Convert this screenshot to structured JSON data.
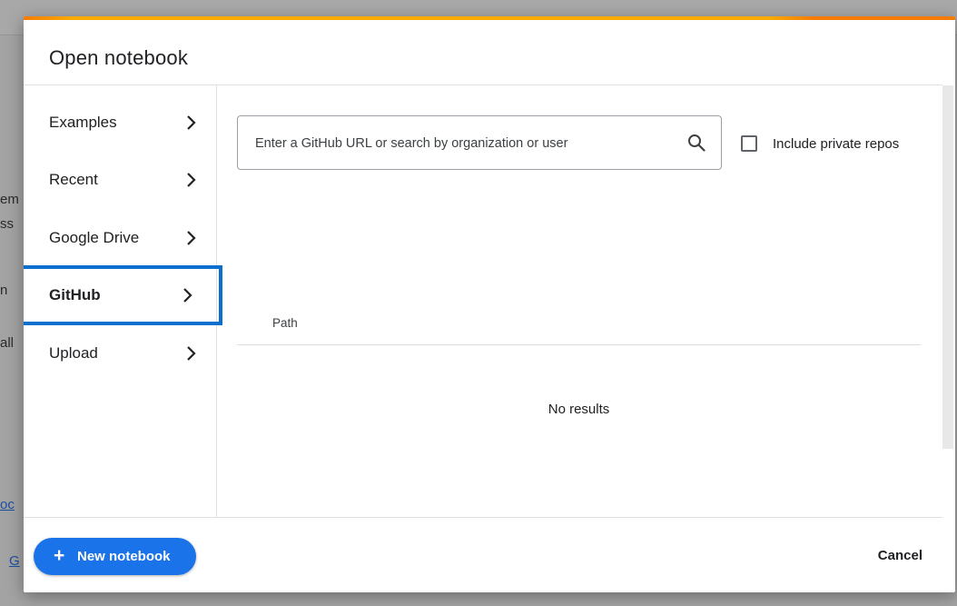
{
  "dialog": {
    "title": "Open notebook"
  },
  "background": {
    "fragments": [
      "em",
      "ss",
      "n",
      "all",
      "oc",
      "G"
    ]
  },
  "sidebar": {
    "items": [
      {
        "label": "Examples",
        "selected": false
      },
      {
        "label": "Recent",
        "selected": false
      },
      {
        "label": "Google Drive",
        "selected": false
      },
      {
        "label": "GitHub",
        "selected": true
      },
      {
        "label": "Upload",
        "selected": false
      }
    ],
    "chevron_icon": "chevron-right-icon"
  },
  "github": {
    "search_placeholder": "Enter a GitHub URL or search by organization or user",
    "search_value": "",
    "search_icon": "search-icon",
    "include_private_label": "Include private repos",
    "include_private_checked": false,
    "table_header_path": "Path",
    "empty_message": "No results"
  },
  "footer": {
    "new_notebook_plus": "+",
    "new_notebook_label": "New notebook",
    "cancel_label": "Cancel"
  },
  "colors": {
    "accent_orange": "#f57c00",
    "accent_yellow": "#f9ab00",
    "primary_blue": "#1a73e8",
    "selection_outline": "#0b6fce",
    "text": "#202124"
  }
}
